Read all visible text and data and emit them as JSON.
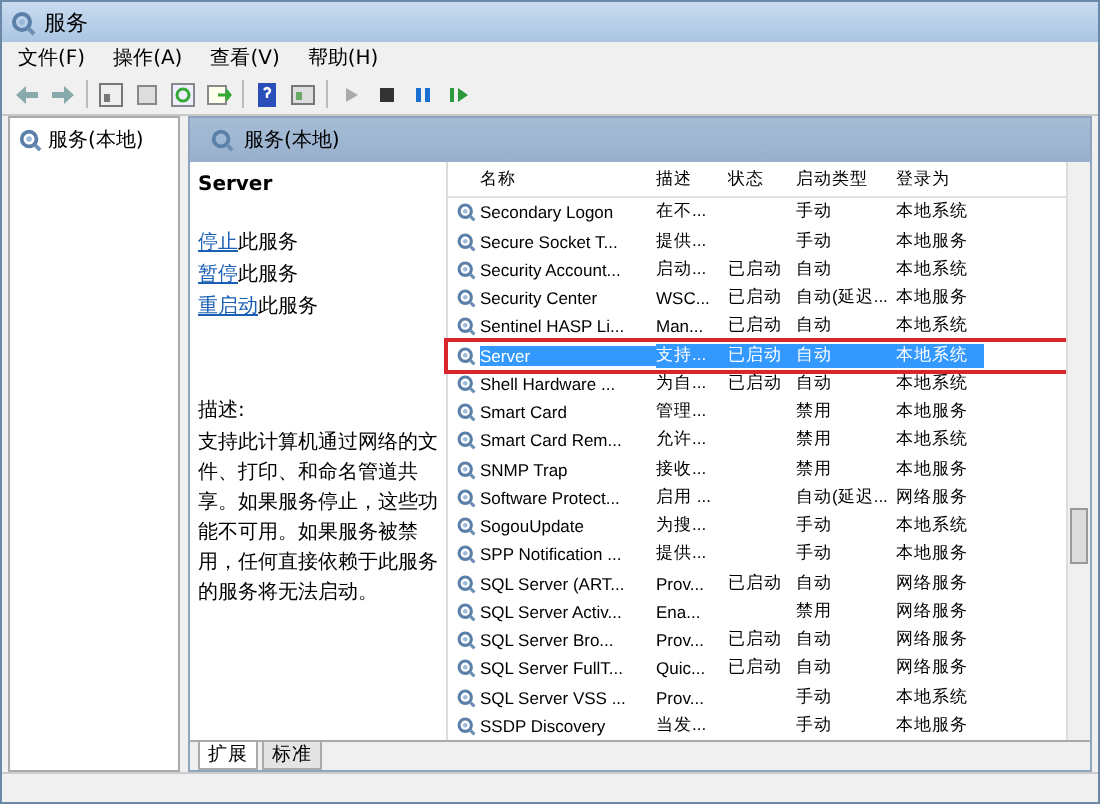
{
  "window": {
    "title": "服务"
  },
  "menu": [
    "文件(F)",
    "操作(A)",
    "查看(V)",
    "帮助(H)"
  ],
  "tree": {
    "items": [
      {
        "label": "服务(本地)",
        "selected": false
      }
    ]
  },
  "header": {
    "title": "服务(本地)"
  },
  "details": {
    "service_name": "Server",
    "actions": [
      {
        "link": "停止",
        "text": "此服务"
      },
      {
        "link": "暂停",
        "text": "此服务"
      },
      {
        "link": "重启动",
        "text": "此服务"
      }
    ],
    "description_label": "描述:",
    "description": "支持此计算机通过网络的文件、打印、和命名管道共享。如果服务停止，这些功能不可用。如果服务被禁用，任何直接依赖于此服务的服务将无法启动。"
  },
  "table": {
    "columns": [
      "名称",
      "描述",
      "状态",
      "启动类型",
      "登录为"
    ],
    "rows": [
      {
        "cells": [
          "Secondary Logon",
          "在不...",
          "",
          "手动",
          "本地系统"
        ],
        "selected": false,
        "outlined": false
      },
      {
        "cells": [
          "Secure Socket T...",
          "提供...",
          "",
          "手动",
          "本地服务"
        ],
        "selected": false,
        "outlined": false
      },
      {
        "cells": [
          "Security Account...",
          "启动...",
          "已启动",
          "自动",
          "本地系统"
        ],
        "selected": false,
        "outlined": false
      },
      {
        "cells": [
          "Security Center",
          "WSC...",
          "已启动",
          "自动(延迟...",
          "本地服务"
        ],
        "selected": false,
        "outlined": false
      },
      {
        "cells": [
          "Sentinel HASP Li...",
          "Man...",
          "已启动",
          "自动",
          "本地系统"
        ],
        "selected": false,
        "outlined": false
      },
      {
        "cells": [
          "Server",
          "支持...",
          "已启动",
          "自动",
          "本地系统"
        ],
        "selected": true,
        "outlined": true
      },
      {
        "cells": [
          "Shell Hardware ...",
          "为自...",
          "已启动",
          "自动",
          "本地系统"
        ],
        "selected": false,
        "outlined": false
      },
      {
        "cells": [
          "Smart Card",
          "管理...",
          "",
          "禁用",
          "本地服务"
        ],
        "selected": false,
        "outlined": false
      },
      {
        "cells": [
          "Smart Card Rem...",
          "允许...",
          "",
          "禁用",
          "本地系统"
        ],
        "selected": false,
        "outlined": false
      },
      {
        "cells": [
          "SNMP Trap",
          "接收...",
          "",
          "禁用",
          "本地服务"
        ],
        "selected": false,
        "outlined": false
      },
      {
        "cells": [
          "Software Protect...",
          "启用 ...",
          "",
          "自动(延迟...",
          "网络服务"
        ],
        "selected": false,
        "outlined": false
      },
      {
        "cells": [
          "SogouUpdate",
          "为搜...",
          "",
          "手动",
          "本地系统"
        ],
        "selected": false,
        "outlined": false
      },
      {
        "cells": [
          "SPP Notification ...",
          "提供...",
          "",
          "手动",
          "本地服务"
        ],
        "selected": false,
        "outlined": false
      },
      {
        "cells": [
          "SQL Server (ART...",
          "Prov...",
          "已启动",
          "自动",
          "网络服务"
        ],
        "selected": false,
        "outlined": false
      },
      {
        "cells": [
          "SQL Server Activ...",
          "Ena...",
          "",
          "禁用",
          "网络服务"
        ],
        "selected": false,
        "outlined": false
      },
      {
        "cells": [
          "SQL Server Bro...",
          "Prov...",
          "已启动",
          "自动",
          "网络服务"
        ],
        "selected": false,
        "outlined": false
      },
      {
        "cells": [
          "SQL Server FullT...",
          "Quic...",
          "已启动",
          "自动",
          "网络服务"
        ],
        "selected": false,
        "outlined": false
      },
      {
        "cells": [
          "SQL Server VSS ...",
          "Prov...",
          "",
          "手动",
          "本地系统"
        ],
        "selected": false,
        "outlined": false
      },
      {
        "cells": [
          "SSDP Discovery",
          "当发...",
          "",
          "手动",
          "本地服务"
        ],
        "selected": false,
        "outlined": false
      }
    ]
  },
  "tabs": [
    {
      "label": "扩展",
      "selected": true
    },
    {
      "label": "标准",
      "selected": false
    }
  ]
}
